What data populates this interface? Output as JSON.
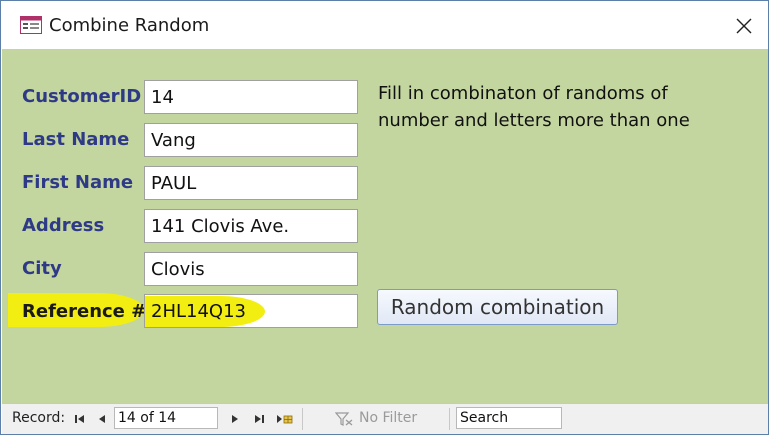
{
  "window": {
    "title": "Combine Random"
  },
  "form": {
    "fields": [
      {
        "label": "CustomerID",
        "value": "14"
      },
      {
        "label": "Last Name",
        "value": "Vang"
      },
      {
        "label": "First Name",
        "value": "PAUL"
      },
      {
        "label": "Address",
        "value": "141 Clovis Ave."
      },
      {
        "label": "City",
        "value": "Clovis"
      },
      {
        "label": "Reference #",
        "value": "2HL14Q13"
      }
    ],
    "note": "Fill in combinaton of randoms of number and letters more than one",
    "button_label": "Random combination",
    "colors": {
      "background": "#c4d69f",
      "label": "#2f3a87",
      "highlight": "#f2ee12"
    }
  },
  "navigation": {
    "record_label": "Record:",
    "record_position": "14 of 14",
    "filter_label": "No Filter",
    "search_placeholder": "Search"
  }
}
